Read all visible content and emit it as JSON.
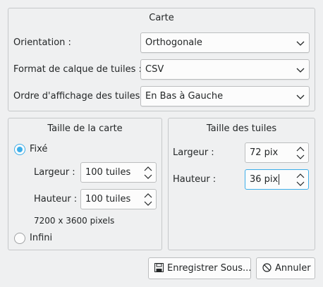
{
  "carte": {
    "title": "Carte",
    "orientation_label": "Orientation :",
    "orientation_value": "Orthogonale",
    "format_label": "Format de calque de tuiles :",
    "format_value": "CSV",
    "ordre_label": "Ordre d'affichage des tuiles :",
    "ordre_value": "En Bas à Gauche"
  },
  "taille_carte": {
    "title": "Taille de la carte",
    "fixe_label": "Fixé",
    "fixe_checked": true,
    "largeur_label": "Largeur :",
    "largeur_value": "100 tuiles",
    "hauteur_label": "Hauteur :",
    "hauteur_value": "100 tuiles",
    "pixels_text": "7200 x 3600 pixels",
    "infini_label": "Infini",
    "infini_checked": false
  },
  "taille_tuiles": {
    "title": "Taille des tuiles",
    "largeur_label": "Largeur :",
    "largeur_value": "72 pix",
    "hauteur_label": "Hauteur :",
    "hauteur_value": "36 pix"
  },
  "buttons": {
    "save_label": "Enregistrer Sous...",
    "cancel_label": "Annuler"
  },
  "icons": {
    "dropdown": "chevron-down-icon",
    "spinner": "spin-arrows-icon",
    "save": "floppy-disk-icon",
    "cancel": "cancel-icon"
  },
  "colors": {
    "accent": "#3daee9",
    "background": "#eff0f1"
  }
}
